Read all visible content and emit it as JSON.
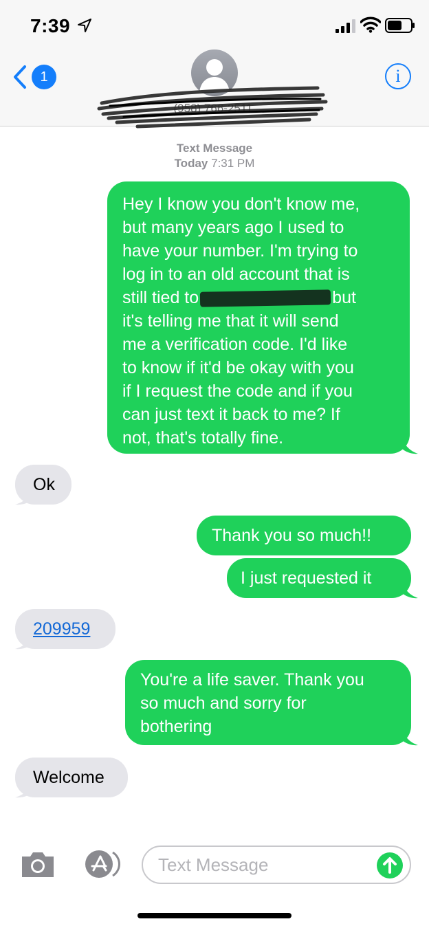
{
  "status_bar": {
    "time": "7:39"
  },
  "header": {
    "back_badge": "1",
    "contact_name": "(958) 766-2511",
    "info_label": "i"
  },
  "thread": {
    "service_label": "Text Message",
    "date_label": "Today",
    "time_label": "7:31 PM"
  },
  "messages": [
    {
      "direction": "outgoing",
      "lines": [
        "Hey I know you don't know me,",
        "but many years ago I used to",
        "have your number. I'm trying to",
        "log in to an old account that is",
        "still tied to",
        "but",
        "it's telling me that it will send",
        "me a verification code. I'd like",
        "to know if it'd be okay with you",
        "if I request the code and if you",
        "can just text it back to me? If",
        "not, that's totally fine."
      ]
    },
    {
      "direction": "incoming",
      "text": "Ok"
    },
    {
      "direction": "outgoing",
      "text": "Thank you so much!!"
    },
    {
      "direction": "outgoing",
      "text": "I just requested it"
    },
    {
      "direction": "incoming",
      "text": "209959"
    },
    {
      "direction": "outgoing",
      "lines": [
        "You're a life saver. Thank you",
        "so much and sorry for",
        "bothering"
      ]
    },
    {
      "direction": "incoming",
      "text": "Welcome"
    }
  ],
  "composer": {
    "placeholder": "Text Message"
  },
  "icons": {
    "location": "location-arrow-icon",
    "signal": "cellular-signal-icon",
    "wifi": "wifi-icon",
    "battery": "battery-icon",
    "back": "chevron-left-icon",
    "avatar": "person-silhouette-icon",
    "info": "info-icon",
    "camera": "camera-icon",
    "apps": "app-store-icon",
    "send": "arrow-up-icon"
  },
  "colors": {
    "outgoing_bubble": "#1fd15a",
    "incoming_bubble": "#e5e5ea",
    "accent_blue": "#147efb",
    "link_blue": "#1469d6",
    "header_bg": "#f7f7f7"
  }
}
